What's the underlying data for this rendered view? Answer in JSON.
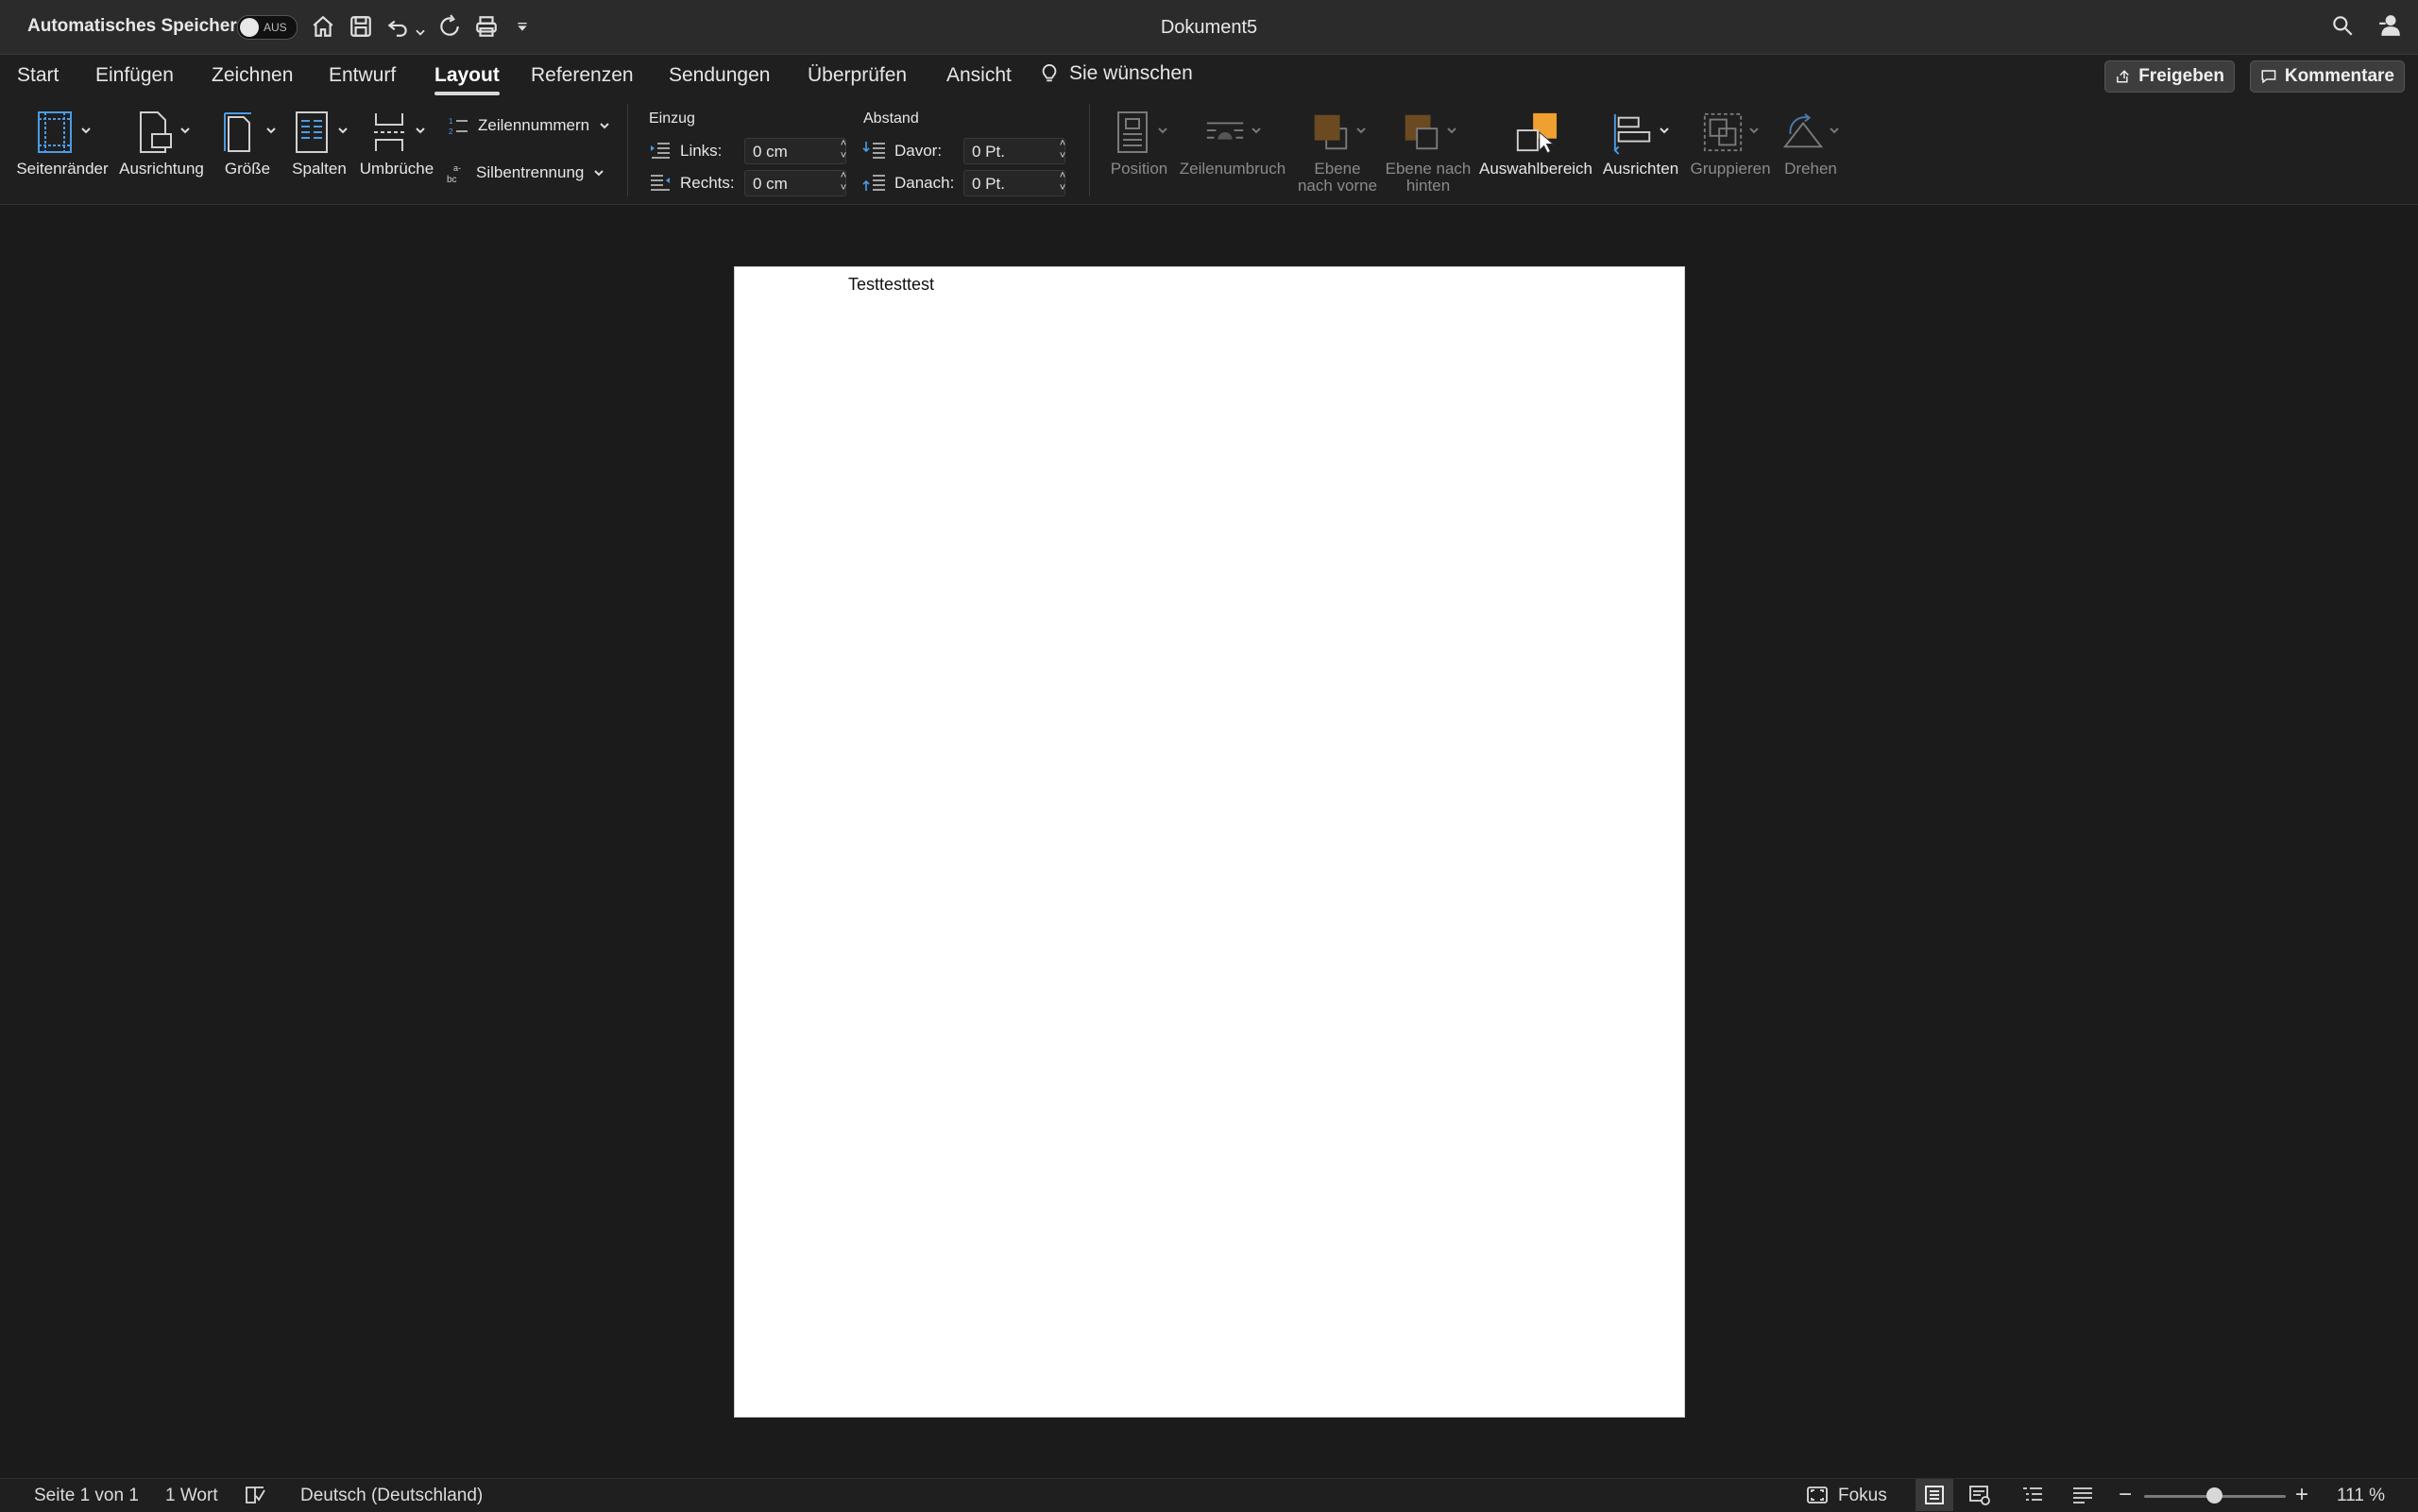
{
  "titlebar": {
    "autosave_label": "Automatisches Speichern",
    "autosave_state": "AUS",
    "document_title": "Dokument5",
    "icons": [
      "home-icon",
      "save-icon",
      "undo-icon",
      "redo-icon",
      "print-icon",
      "customize-icon",
      "search-icon",
      "share-person-icon"
    ]
  },
  "tabs": [
    {
      "label": "Start"
    },
    {
      "label": "Einfügen"
    },
    {
      "label": "Zeichnen"
    },
    {
      "label": "Entwurf"
    },
    {
      "label": "Layout",
      "active": true
    },
    {
      "label": "Referenzen"
    },
    {
      "label": "Sendungen"
    },
    {
      "label": "Überprüfen"
    },
    {
      "label": "Ansicht"
    }
  ],
  "tell_me": "Sie wünschen",
  "share_button": "Freigeben",
  "comments_button": "Kommentare",
  "ribbon": {
    "margins": "Seitenränder",
    "orientation": "Ausrichtung",
    "size": "Größe",
    "columns": "Spalten",
    "breaks": "Umbrüche",
    "line_numbers": "Zeilennummern",
    "hyphenation": "Silbentrennung",
    "indent": {
      "title": "Einzug",
      "left_label": "Links:",
      "left_value": "0 cm",
      "right_label": "Rechts:",
      "right_value": "0 cm"
    },
    "spacing": {
      "title": "Abstand",
      "before_label": "Davor:",
      "before_value": "0 Pt.",
      "after_label": "Danach:",
      "after_value": "0 Pt."
    },
    "position": "Position",
    "wrap_text": "Zeilenumbruch",
    "bring_forward_1": "Ebene",
    "bring_forward_2": "nach vorne",
    "send_backward_1": "Ebene nach",
    "send_backward_2": "hinten",
    "selection_pane": "Auswahlbereich",
    "align": "Ausrichten",
    "group": "Gruppieren",
    "rotate": "Drehen"
  },
  "document": {
    "text": "Testtesttest"
  },
  "statusbar": {
    "page": "Seite 1 von 1",
    "words": "1 Wort",
    "language": "Deutsch (Deutschland)",
    "focus": "Fokus",
    "zoom": "111 %",
    "zoom_minus": "−",
    "zoom_plus": "+"
  },
  "colors": {
    "accent_orange": "#f0a030",
    "text_blue": "#4a9be8",
    "page_bg": "#ffffff"
  }
}
